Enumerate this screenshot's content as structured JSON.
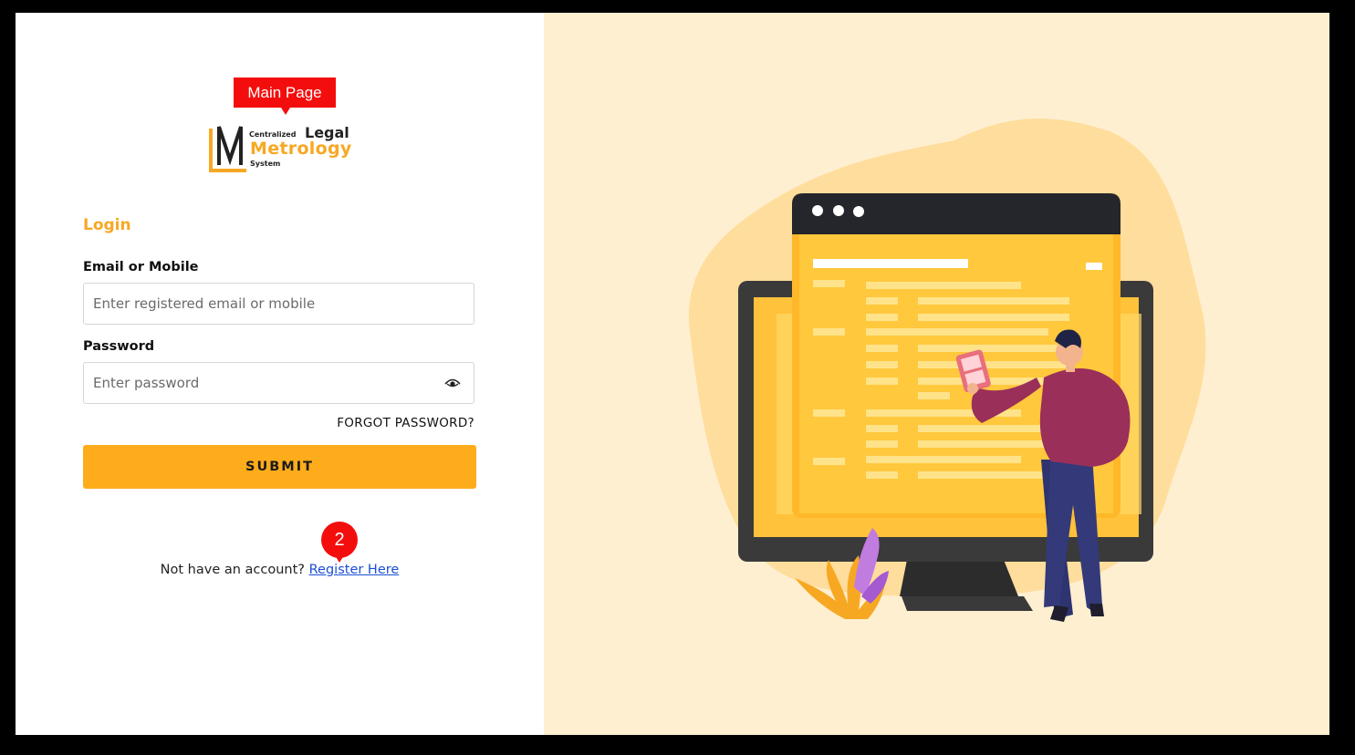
{
  "annotation": {
    "label": "Main Page",
    "badge": "2"
  },
  "logo": {
    "word_centralized": "Centralized",
    "word_legal": "Legal",
    "word_metrology": "Metrology",
    "word_system": "System"
  },
  "login": {
    "heading": "Login",
    "email_label": "Email or Mobile",
    "email_placeholder": "Enter registered email or mobile",
    "password_label": "Password",
    "password_placeholder": "Enter password",
    "forgot_label": "FORGOT PASSWORD?",
    "submit_label": "SUBMIT",
    "register_prompt": "Not have an account?",
    "register_link": "Register Here"
  },
  "colors": {
    "accent": "#feac1b",
    "logo_orange": "#f7a823",
    "annotation_red": "#f40d0d",
    "link_blue": "#1c4fd6",
    "illustration_bg": "#ffefd1"
  },
  "icons": {
    "password_toggle": "eye-icon",
    "illustration": "person-at-monitor-illustration"
  }
}
